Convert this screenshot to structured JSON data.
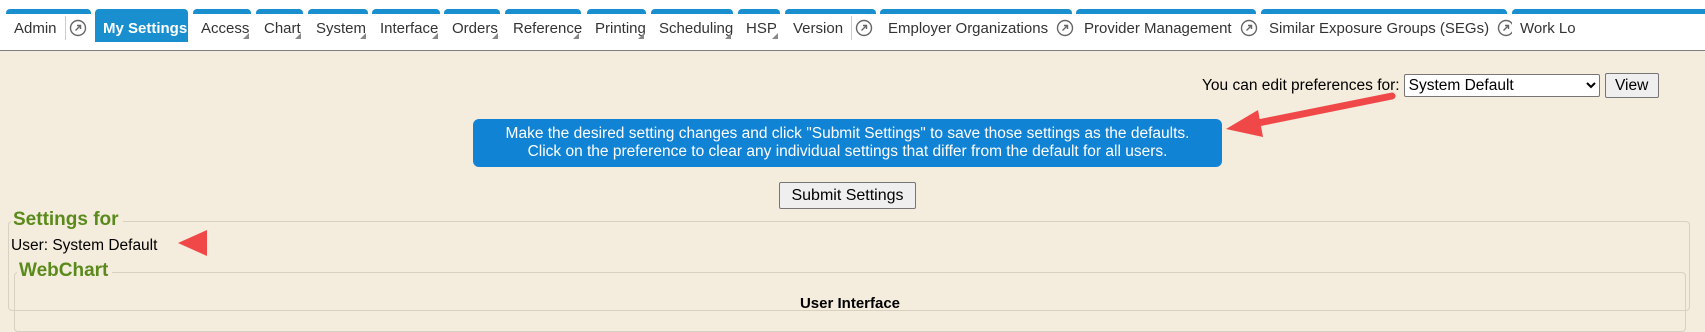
{
  "tabs": [
    {
      "label": "Admin",
      "ext_icon": "external-link-icon"
    },
    {
      "label": "My Settings",
      "active": true
    },
    {
      "label": "Access"
    },
    {
      "label": "Chart"
    },
    {
      "label": "System"
    },
    {
      "label": "Interface"
    },
    {
      "label": "Orders"
    },
    {
      "label": "Reference"
    },
    {
      "label": "Printing"
    },
    {
      "label": "Scheduling"
    },
    {
      "label": "HSP"
    },
    {
      "label": "Version",
      "ext_icon": "external-link-icon"
    },
    {
      "label": "Employer Organizations",
      "ext_icon": "external-link-icon"
    },
    {
      "label": "Provider Management",
      "ext_icon": "external-link-icon"
    },
    {
      "label": "Similar Exposure Groups (SEGs)",
      "ext_icon": "external-link-icon"
    },
    {
      "label": "Work Lo"
    }
  ],
  "preferences": {
    "label": "You can edit preferences for:",
    "selected": "System Default",
    "view_button": "View"
  },
  "notice": {
    "line1": "Make the desired setting changes and click \"Submit Settings\" to save those settings as the defaults.",
    "line2": "Click on the preference to clear any individual settings that differ from the default for all users."
  },
  "submit_button": "Submit Settings",
  "settings": {
    "legend": "Settings for",
    "user_line": "User: System Default",
    "section": {
      "legend": "WebChart",
      "heading": "User Interface"
    }
  },
  "colors": {
    "tab_accent": "#1a8fd0",
    "notice_bg": "#1183d5",
    "legend_green": "#5a8a1c",
    "page_bg": "#f4ecdc",
    "arrow_red": "#f04848"
  }
}
